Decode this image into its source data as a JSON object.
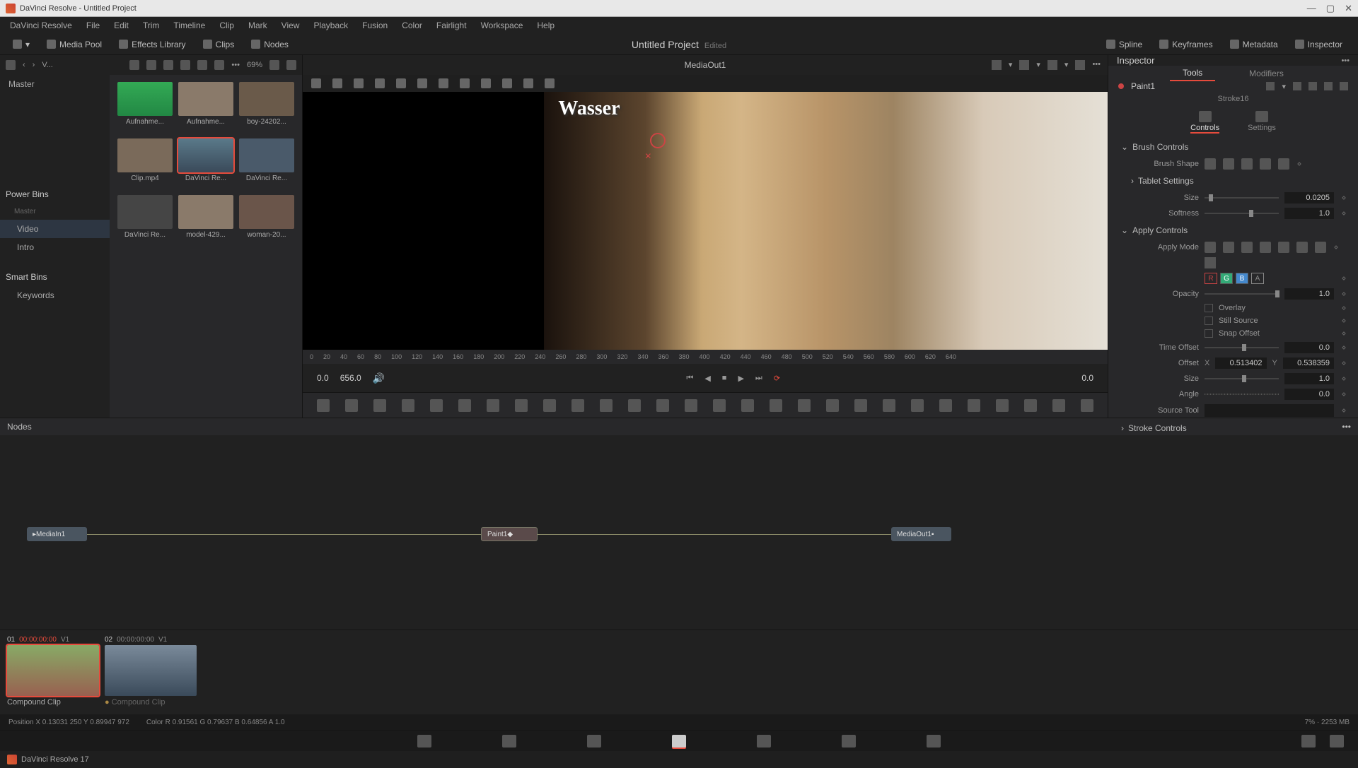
{
  "title": "DaVinci Resolve - Untitled Project",
  "menubar": [
    "DaVinci Resolve",
    "File",
    "Edit",
    "Trim",
    "Timeline",
    "Clip",
    "Mark",
    "View",
    "Playback",
    "Fusion",
    "Color",
    "Fairlight",
    "Workspace",
    "Help"
  ],
  "toolbar": {
    "left": [
      "Media Pool",
      "Effects Library",
      "Clips",
      "Nodes"
    ],
    "project": "Untitled Project",
    "edited": "Edited",
    "right": [
      "Spline",
      "Keyframes",
      "Metadata",
      "Inspector"
    ]
  },
  "mediaTop": {
    "label": "V...",
    "zoom": "69%"
  },
  "tree": {
    "master": "Master",
    "power": "Power Bins",
    "items": [
      "Master",
      "Video",
      "Intro"
    ],
    "smart": "Smart Bins",
    "keywords": "Keywords"
  },
  "thumbs": [
    "Aufnahme...",
    "Aufnahme...",
    "boy-24202...",
    "Clip.mp4",
    "DaVinci Re...",
    "DaVinci Re...",
    "DaVinci Re...",
    "model-429...",
    "woman-20..."
  ],
  "viewer": {
    "name": "MediaOut1",
    "wm": "Wasser",
    "ruler": [
      "0",
      "20",
      "40",
      "60",
      "80",
      "100",
      "120",
      "140",
      "160",
      "180",
      "200",
      "220",
      "240",
      "260",
      "280",
      "300",
      "320",
      "340",
      "360",
      "380",
      "400",
      "420",
      "440",
      "460",
      "480",
      "500",
      "520",
      "540",
      "560",
      "580",
      "600",
      "620",
      "640"
    ],
    "tcL": "0.0",
    "tcM": "656.0",
    "tcR": "0.0"
  },
  "inspector": {
    "title": "Inspector",
    "tabs": [
      "Tools",
      "Modifiers"
    ],
    "node": "Paint1",
    "stroke": "Stroke16",
    "cs": [
      "Controls",
      "Settings"
    ],
    "sect1": "Brush Controls",
    "brushShape": "Brush Shape",
    "tablet": "Tablet Settings",
    "size": "Size",
    "sizeVal": "0.0205",
    "softness": "Softness",
    "softVal": "1.0",
    "sect2": "Apply Controls",
    "applyMode": "Apply Mode",
    "opacity": "Opacity",
    "opVal": "1.0",
    "overlay": "Overlay",
    "still": "Still Source",
    "snap": "Snap Offset",
    "timeOff": "Time Offset",
    "timeVal": "0.0",
    "offset": "Offset",
    "offX": "0.513402",
    "offY": "0.538359",
    "size2": "Size",
    "size2Val": "1.0",
    "angle": "Angle",
    "angleVal": "0.0",
    "srcTool": "Source Tool",
    "sect3": "Stroke Controls"
  },
  "nodes": {
    "title": "Nodes",
    "n1": "MediaIn1",
    "n2": "Paint1",
    "n3": "MediaOut1"
  },
  "clips": {
    "c1": {
      "num": "01",
      "tc": "00:00:00:00",
      "trk": "V1",
      "name": "Compound Clip"
    },
    "c2": {
      "num": "02",
      "tc": "00:00:00:00",
      "trk": "V1",
      "name": "Compound Clip"
    }
  },
  "status": {
    "pos": "Position   X 0.13031   250    Y 0.89947   972",
    "col": "Color R 0.91561   G 0.79637   B 0.64856   A 1.0",
    "mem": "7%  ·  2253 MB"
  },
  "footer": "DaVinci Resolve 17"
}
